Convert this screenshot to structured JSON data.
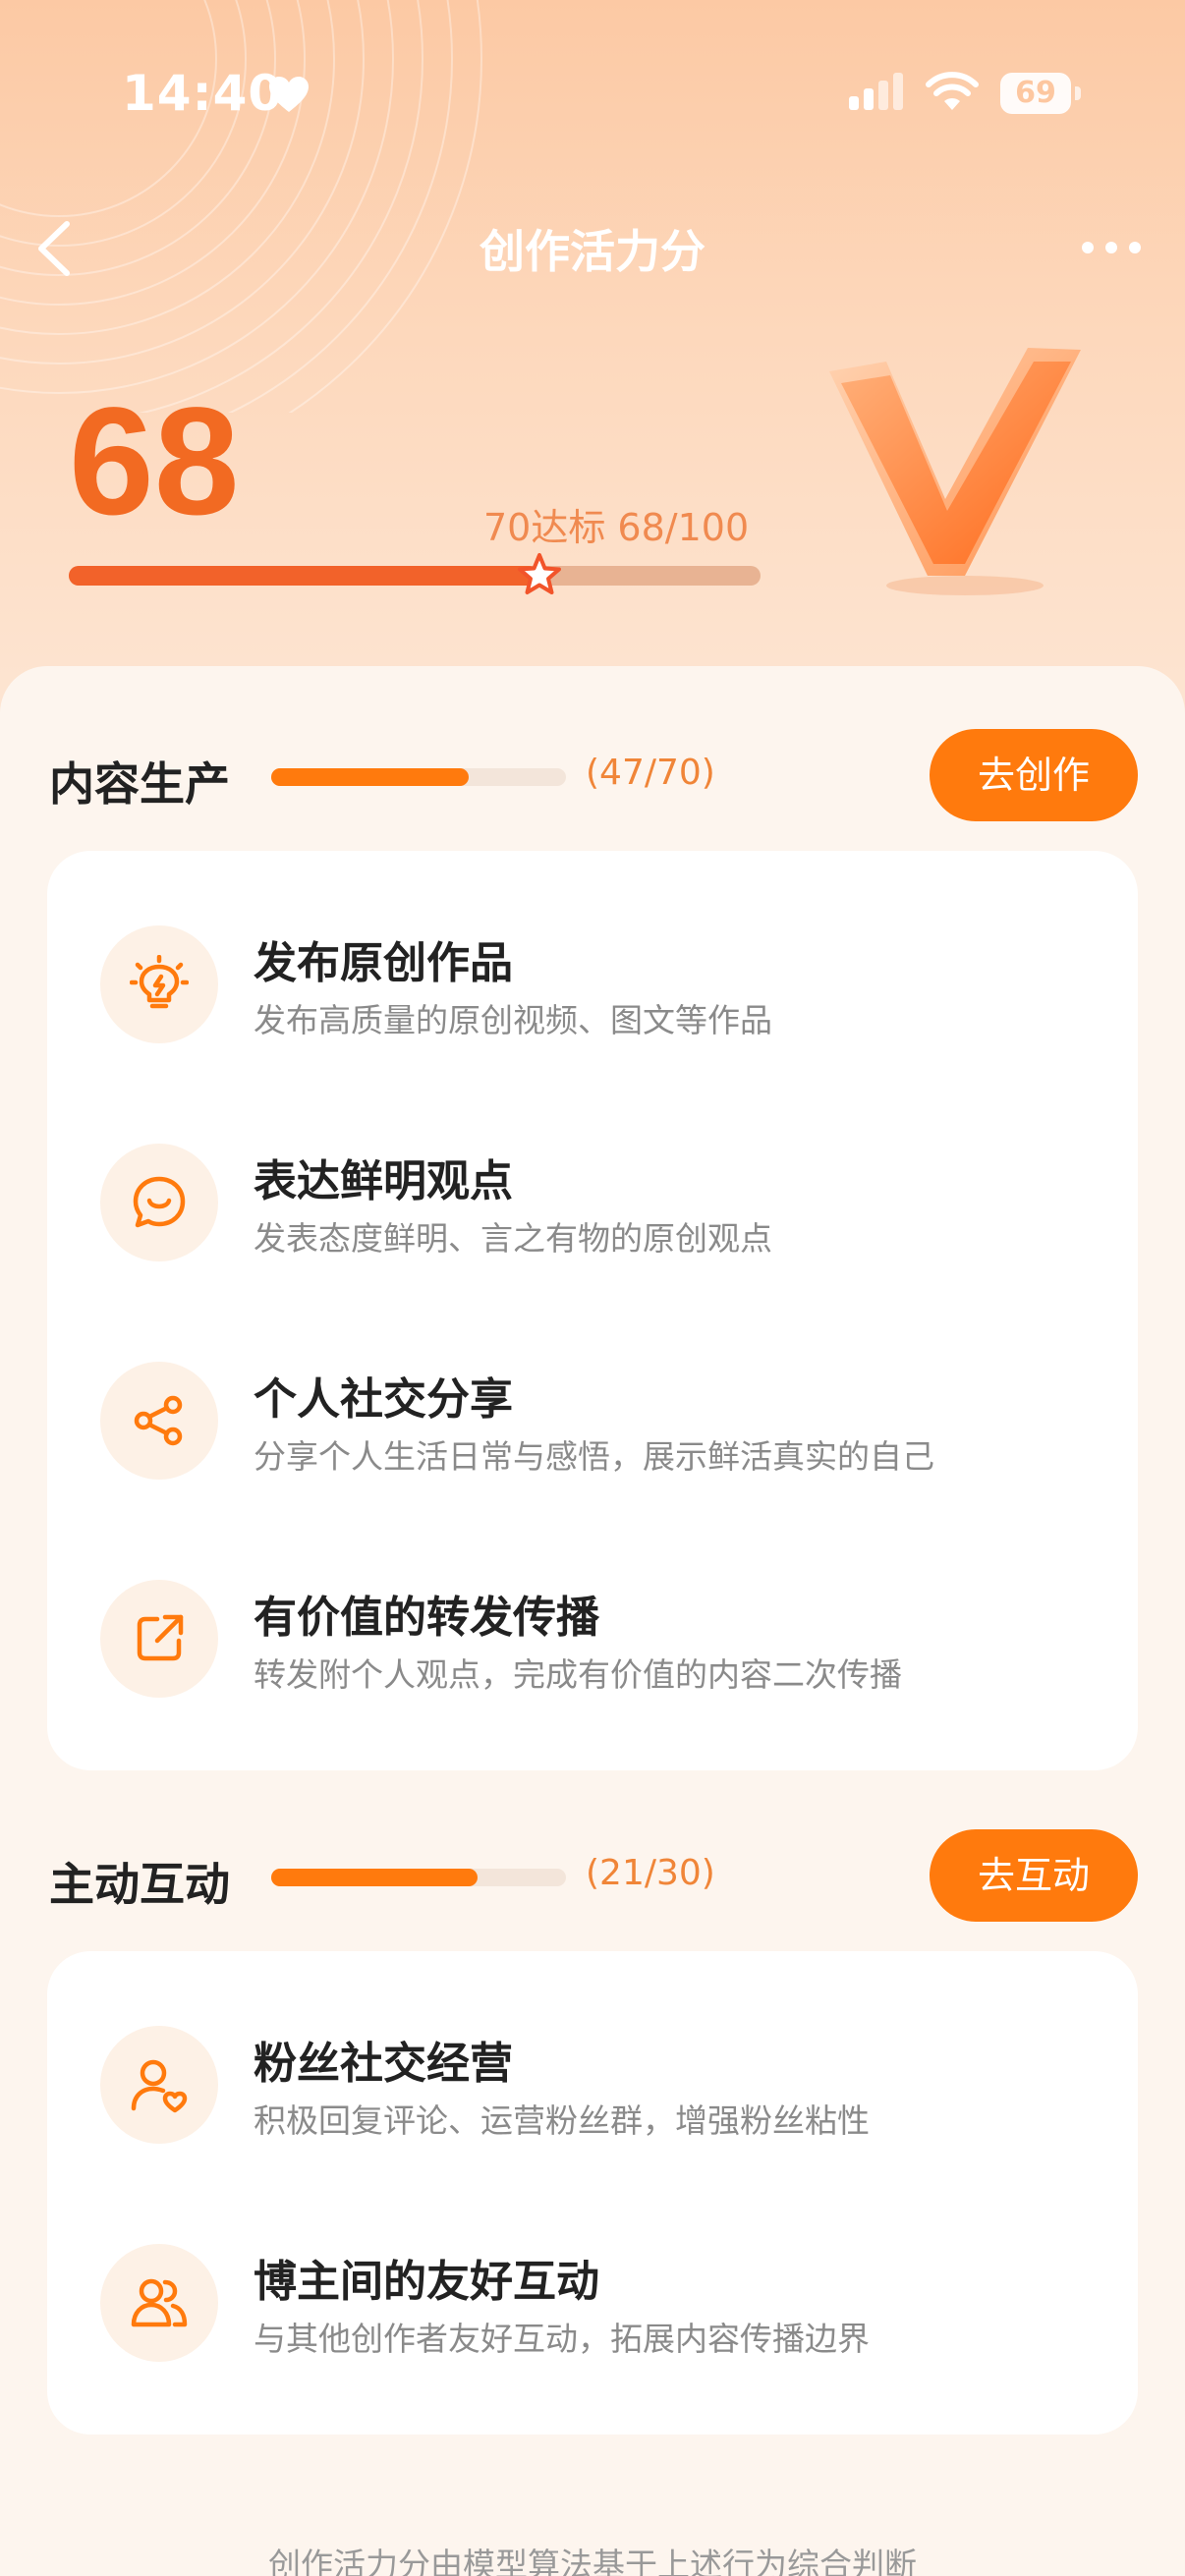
{
  "status_bar": {
    "time": "14:40",
    "battery": "69"
  },
  "nav": {
    "title": "创作活力分"
  },
  "score": {
    "value": "68",
    "target_text": "70达标 68/100",
    "progress_fraction": 0.68
  },
  "sections": [
    {
      "title": "内容生产",
      "count": "(47/70)",
      "progress_fraction": 0.671,
      "button": "去创作",
      "items": [
        {
          "icon": "lightbulb-icon",
          "title": "发布原创作品",
          "desc": "发布高质量的原创视频、图文等作品"
        },
        {
          "icon": "speech-bubble-icon",
          "title": "表达鲜明观点",
          "desc": "发表态度鲜明、言之有物的原创观点"
        },
        {
          "icon": "share-icon",
          "title": "个人社交分享",
          "desc": "分享个人生活日常与感悟，展示鲜活真实的自己"
        },
        {
          "icon": "forward-icon",
          "title": "有价值的转发传播",
          "desc": "转发附个人观点，完成有价值的内容二次传播"
        }
      ]
    },
    {
      "title": "主动互动",
      "count": "(21/30)",
      "progress_fraction": 0.7,
      "button": "去互动",
      "items": [
        {
          "icon": "fan-user-heart-icon",
          "title": "粉丝社交经营",
          "desc": "积极回复评论、运营粉丝群，增强粉丝粘性"
        },
        {
          "icon": "two-users-icon",
          "title": "博主间的友好互动",
          "desc": "与其他创作者友好互动，拓展内容传播边界"
        }
      ]
    }
  ],
  "footer": {
    "note": "创作活力分由模型算法基于上述行为综合判断"
  },
  "colors": {
    "accent": "#ff7a0d",
    "score": "#f26a22",
    "hero_top": "#fcc9a4"
  }
}
